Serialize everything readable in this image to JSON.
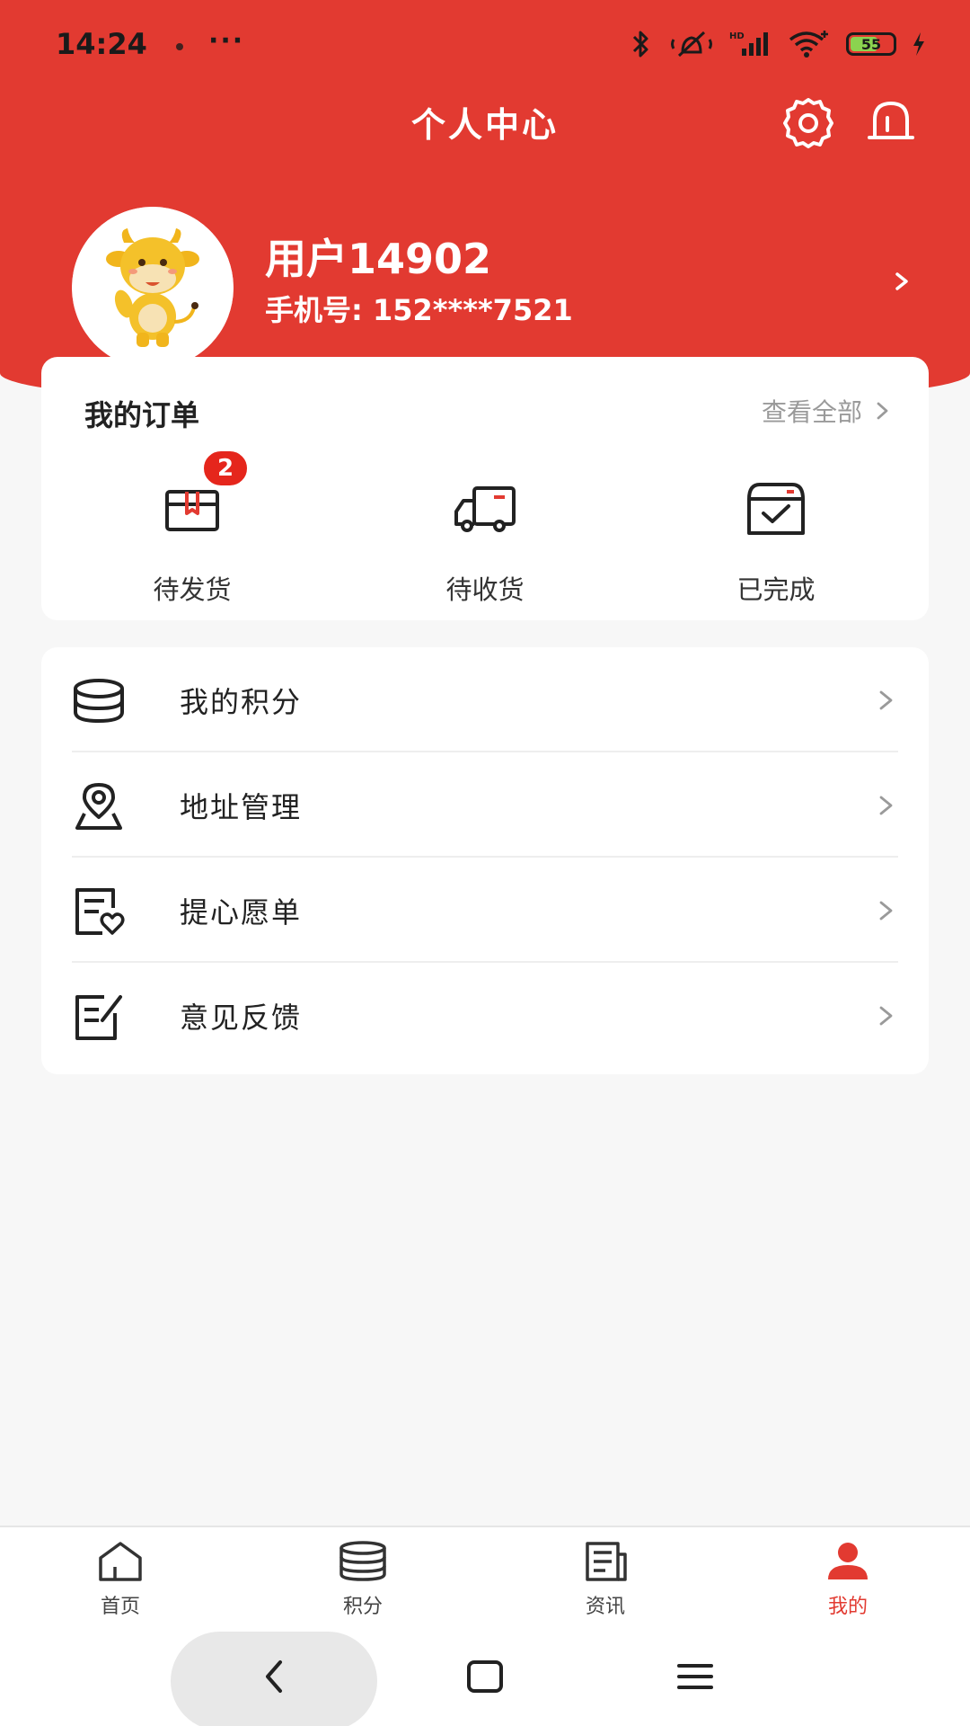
{
  "status_bar": {
    "time": "14:24",
    "more": "···",
    "battery": "55"
  },
  "header": {
    "title": "个人中心",
    "icons": [
      "settings-icon",
      "bell-icon"
    ]
  },
  "profile": {
    "username": "用户14902",
    "phone": "手机号: 152****7521"
  },
  "orders": {
    "title": "我的订单",
    "view_all": "查看全部",
    "items": [
      {
        "label": "待发货",
        "icon": "package-icon",
        "badge": "2"
      },
      {
        "label": "待收货",
        "icon": "truck-icon"
      },
      {
        "label": "已完成",
        "icon": "completed-box-icon"
      }
    ]
  },
  "menu": {
    "items": [
      {
        "label": "我的积分",
        "icon": "points-icon"
      },
      {
        "label": "地址管理",
        "icon": "location-icon"
      },
      {
        "label": "提心愿单",
        "icon": "wishlist-icon"
      },
      {
        "label": "意见反馈",
        "icon": "feedback-icon"
      }
    ]
  },
  "tab_bar": {
    "items": [
      {
        "label": "首页",
        "icon": "home-icon"
      },
      {
        "label": "积分",
        "icon": "coins-icon"
      },
      {
        "label": "资讯",
        "icon": "news-icon"
      },
      {
        "label": "我的",
        "icon": "user-icon",
        "active": true
      }
    ]
  },
  "colors": {
    "brand": "#e23a31",
    "badge": "#e5261c",
    "background": "#f7f7f7"
  }
}
